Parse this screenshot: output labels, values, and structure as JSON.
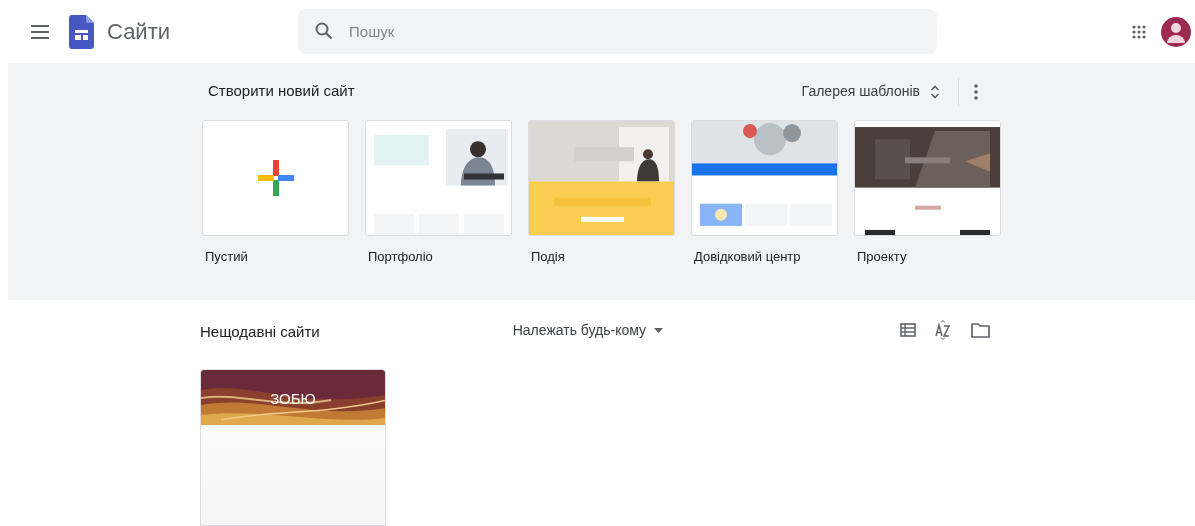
{
  "app": {
    "title": "Сайти"
  },
  "search": {
    "placeholder": "Пошук"
  },
  "create": {
    "title": "Створити новий сайт",
    "gallery": "Галерея шаблонів",
    "templates": [
      {
        "kind": "blank",
        "label": "Пустий"
      },
      {
        "kind": "picture",
        "label": "Портфоліо"
      },
      {
        "kind": "picture",
        "label": "Подія"
      },
      {
        "kind": "picture",
        "label": "Довідковий центр"
      },
      {
        "kind": "picture",
        "label": "Проекту"
      }
    ]
  },
  "recent": {
    "title": "Нещодавні сайти",
    "owner_filter": "Належать будь-кому",
    "sites": [
      {
        "title": "ЗОБЮ"
      }
    ]
  }
}
